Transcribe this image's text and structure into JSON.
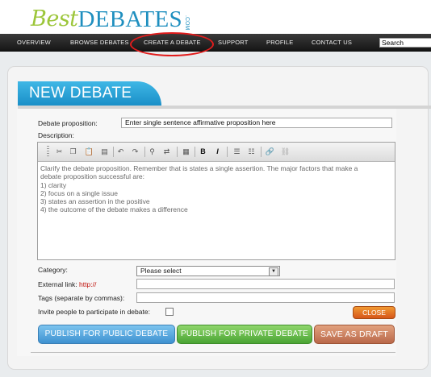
{
  "logo": {
    "part1": "Best",
    "part2": "DEBATES",
    "part3": ".COM"
  },
  "nav": {
    "items": [
      "OVERVIEW",
      "BROWSE DEBATES",
      "CREATE A DEBATE",
      "SUPPORT",
      "PROFILE",
      "CONTACT US"
    ],
    "search_value": "Search"
  },
  "page": {
    "title": "NEW DEBATE"
  },
  "form": {
    "proposition_label": "Debate proposition:",
    "proposition_value": "Enter single sentence affirmative proposition here",
    "description_label": "Description:",
    "description_lines": [
      "Clarify the debate proposition. Remember that is states a single assertion. The major factors that make a",
      "debate proposition successful are:",
      "1) clarity",
      "2) focus on a single issue",
      "3) states an assertion in the positive",
      "4) the outcome of the debate makes a difference"
    ],
    "category_label": "Category:",
    "category_value": "Please select",
    "external_link_label": "External link:",
    "external_link_prefix": "http://",
    "tags_label": "Tags (separate by commas):",
    "invite_label": "Invite people to participate in debate:"
  },
  "toolbar": {
    "icons": [
      "cut-icon",
      "copy-icon",
      "paste-icon",
      "paste-word-icon",
      "undo-icon",
      "redo-icon",
      "find-icon",
      "replace-icon",
      "select-all-icon",
      "bold-icon",
      "italic-icon",
      "numbered-list-icon",
      "bullet-list-icon",
      "link-icon",
      "unlink-icon"
    ],
    "bold_glyph": "B",
    "italic_glyph": "I"
  },
  "buttons": {
    "close": "CLOSE",
    "publish_public": "PUBLISH FOR PUBLIC DEBATE",
    "publish_private": "PUBLISH FOR PRIVATE DEBATE",
    "save_draft": "SAVE AS DRAFT"
  },
  "colors": {
    "nav_bg": "#1c1c1c",
    "banner": "#2aa7dd",
    "highlight": "#e21c1c",
    "public_btn": "#4c9fd9",
    "private_btn": "#5db543",
    "draft_btn": "#c4744f",
    "close_btn": "#e0692a"
  }
}
